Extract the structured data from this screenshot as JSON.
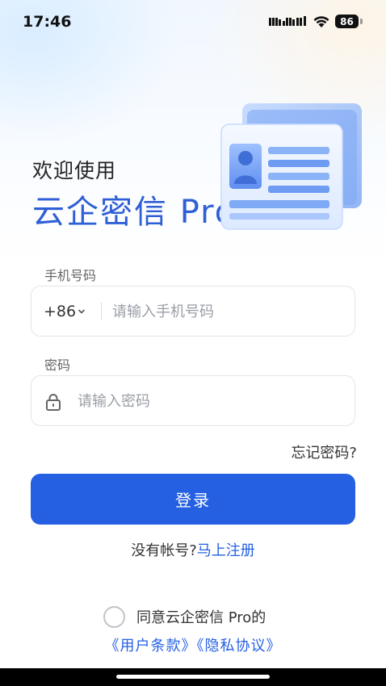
{
  "status_bar": {
    "time": "17:46",
    "battery": "86"
  },
  "hero": {
    "welcome": "欢迎使用",
    "brand": "云企密信 Pro"
  },
  "phone_field": {
    "label": "手机号码",
    "country_code": "+86",
    "placeholder": "请输入手机号码",
    "value": ""
  },
  "password_field": {
    "label": "密码",
    "placeholder": "请输入密码",
    "value": ""
  },
  "forgot_password": "忘记密码?",
  "login_button": "登录",
  "register": {
    "prompt": "没有帐号?",
    "link": "马上注册"
  },
  "agreement": {
    "checked": false,
    "text": "同意云企密信 Pro的",
    "links": "《用户条款》《隐私协议》"
  },
  "colors": {
    "accent": "#2560e3",
    "brand_text": "#2f5fd6",
    "border": "#e3e5ea"
  },
  "icons": [
    "signal-icon",
    "wifi-icon",
    "battery-icon",
    "chevron-down-icon",
    "lock-icon",
    "id-card-illustration",
    "radio-checkbox"
  ]
}
